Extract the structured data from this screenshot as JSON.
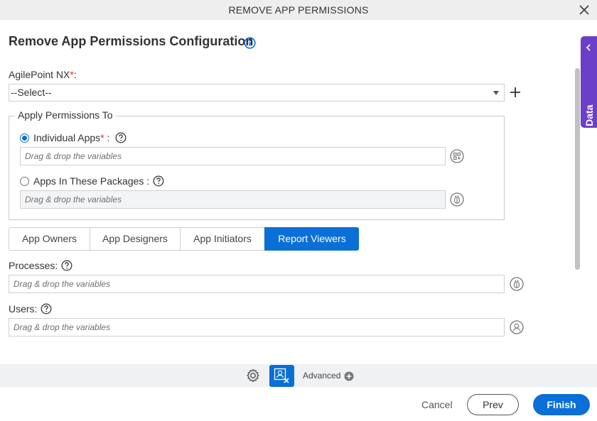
{
  "window": {
    "title": "REMOVE APP PERMISSIONS"
  },
  "heading": "Remove App Permissions Configuration",
  "agilepoint": {
    "label": "AgilePoint NX",
    "required_mark": "*",
    "suffix": ":",
    "selected": "--Select--"
  },
  "apply_to": {
    "legend": "Apply Permissions To",
    "individual": {
      "label": "Individual Apps",
      "required_mark": "*",
      "suffix": " :",
      "placeholder": "Drag & drop the variables",
      "selected": true
    },
    "packages": {
      "label": "Apps In These Packages :",
      "placeholder": "Drag & drop the variables",
      "selected": false
    }
  },
  "tabs": [
    {
      "label": "App Owners",
      "active": false
    },
    {
      "label": "App Designers",
      "active": false
    },
    {
      "label": "App Initiators",
      "active": false
    },
    {
      "label": "Report Viewers",
      "active": true
    }
  ],
  "processes": {
    "label": "Processes:",
    "placeholder": "Drag & drop the variables"
  },
  "users": {
    "label": "Users:",
    "placeholder": "Drag & drop the variables"
  },
  "side_panel": {
    "label": "App Data"
  },
  "footer": {
    "advanced_label": "Advanced",
    "cancel": "Cancel",
    "prev": "Prev",
    "finish": "Finish"
  },
  "colors": {
    "primary": "#0a6fd6",
    "app_data": "#6c3fc9",
    "required": "#e8242a"
  }
}
